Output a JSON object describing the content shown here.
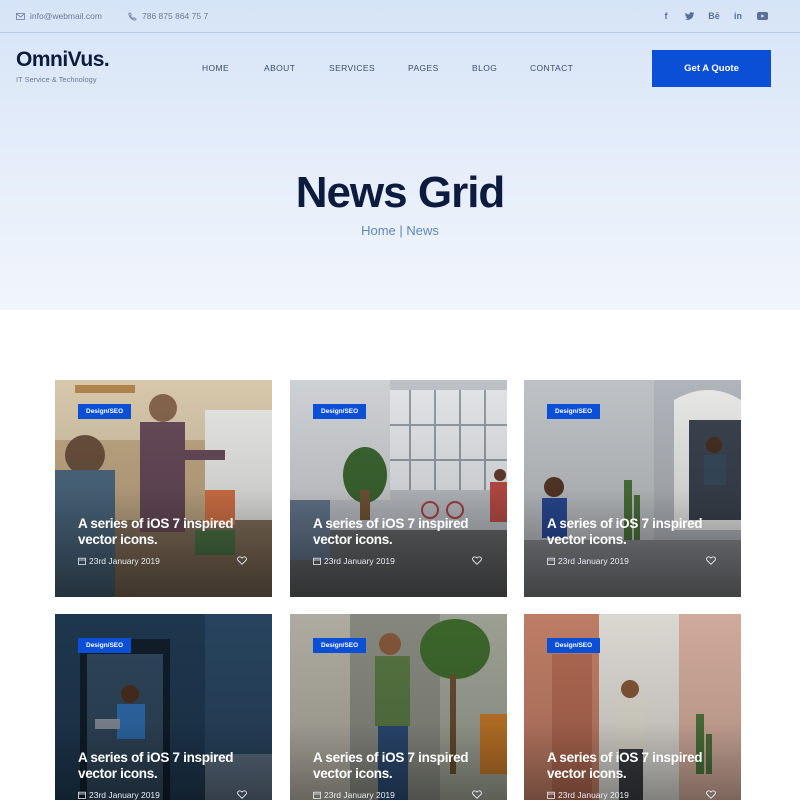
{
  "topbar": {
    "email": "info@webmail.com",
    "phone": "786 875 864 75 7",
    "social": [
      {
        "icon": "facebook-icon",
        "glyph": "f"
      },
      {
        "icon": "twitter-icon",
        "glyph": "t"
      },
      {
        "icon": "behance-icon",
        "glyph": "Bē"
      },
      {
        "icon": "linkedin-icon",
        "glyph": "in"
      },
      {
        "icon": "youtube-icon",
        "glyph": "▶"
      }
    ]
  },
  "logo": {
    "name": "OmniVus.",
    "tagline": "IT Service & Technology"
  },
  "nav": {
    "items": [
      "HOME",
      "ABOUT",
      "SERVICES",
      "PAGES",
      "BLOG",
      "CONTACT"
    ],
    "cta": "Get A Quote"
  },
  "hero": {
    "title": "News Grid",
    "breadcrumb": "Home | News"
  },
  "posts": [
    {
      "category": "Design/SEO",
      "title": "A series of iOS 7 inspired vector icons.",
      "date": "23rd January 2019"
    },
    {
      "category": "Design/SEO",
      "title": "A series of iOS 7 inspired vector icons.",
      "date": "23rd January 2019"
    },
    {
      "category": "Design/SEO",
      "title": "A series of iOS 7 inspired vector icons.",
      "date": "23rd January 2019"
    },
    {
      "category": "Design/SEO",
      "title": "A series of iOS 7 inspired vector icons.",
      "date": "23rd January 2019"
    },
    {
      "category": "Design/SEO",
      "title": "A series of iOS 7 inspired vector icons.",
      "date": "23rd January 2019"
    },
    {
      "category": "Design/SEO",
      "title": "A series of iOS 7 inspired vector icons.",
      "date": "23rd January 2019"
    }
  ],
  "colors": {
    "accent": "#0b4fd6",
    "heading": "#0d1b3e",
    "breadcrumb": "#5d87b6"
  }
}
